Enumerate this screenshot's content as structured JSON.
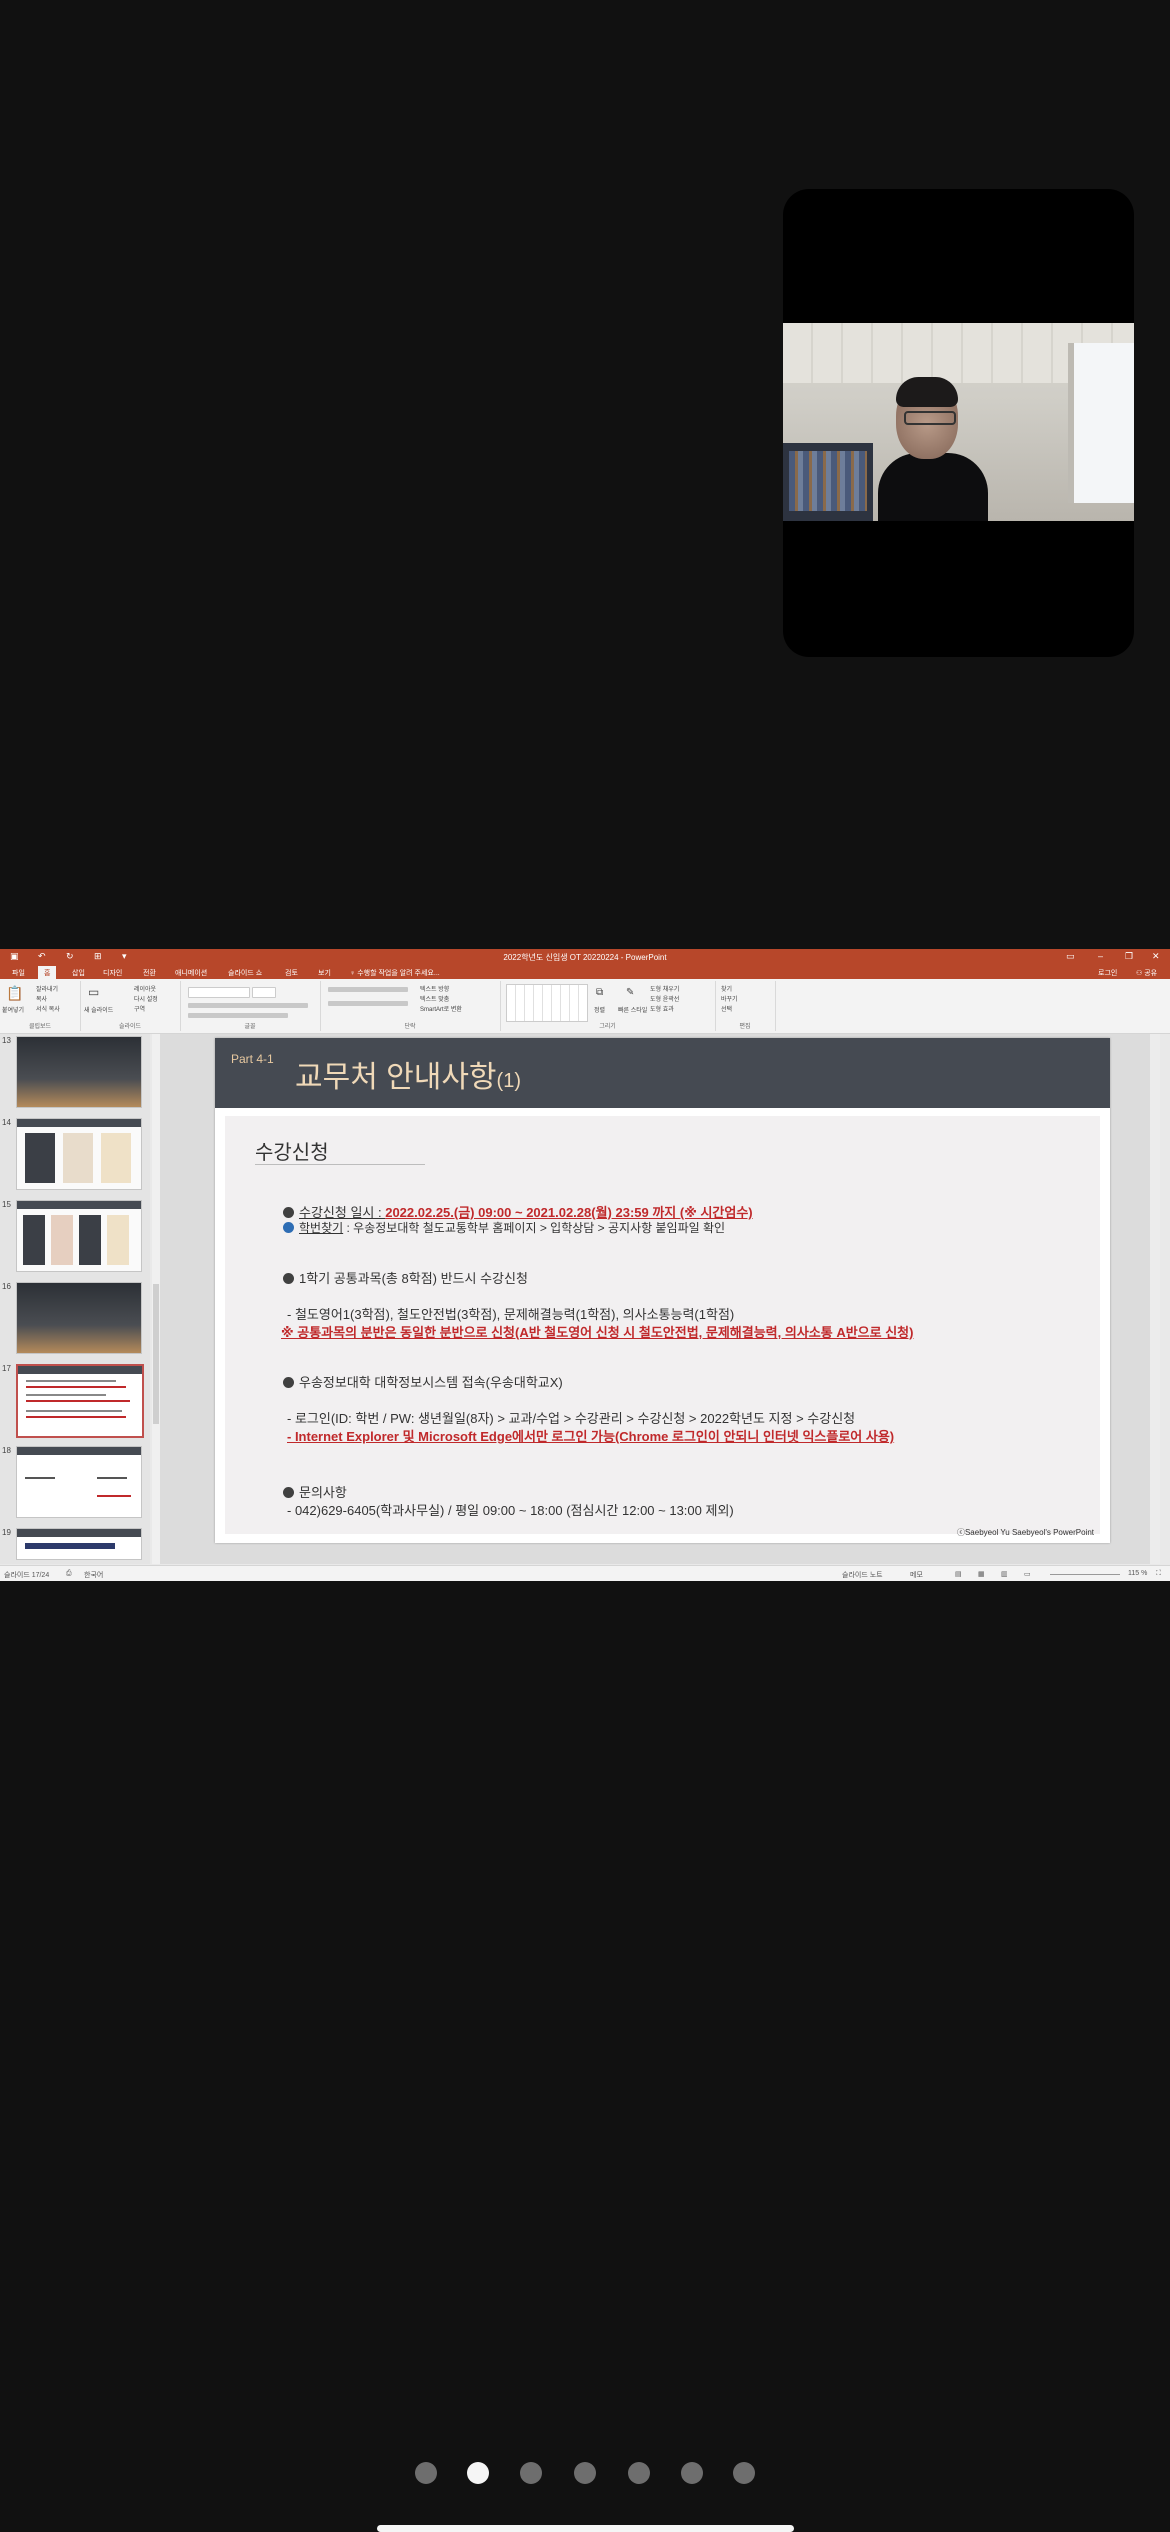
{
  "ppt": {
    "window_title": "2022학년도 신입생 OT 20220224 - PowerPoint",
    "tabs": [
      "파일",
      "홈",
      "삽입",
      "디자인",
      "전환",
      "애니메이션",
      "슬라이드 쇼",
      "검토",
      "보기"
    ],
    "search_hint": "수행할 작업을 알려 주세요...",
    "right_labels": [
      "로그인",
      "공유"
    ],
    "ribbon_groups": [
      "클립보드",
      "슬라이드",
      "글꼴",
      "단락",
      "그리기",
      "편집"
    ],
    "ribbon_buttons": {
      "paste": "붙여넣기",
      "cut": "잘라내기",
      "copy": "복사",
      "format_painter": "서식 복사",
      "new_slide": "새 슬라이드",
      "layout": "레이아웃",
      "reset": "다시 설정",
      "section": "구역",
      "text_direction": "텍스트 방향",
      "align_text": "텍스트 맞춤",
      "smartart": "SmartArt로 변환",
      "arrange": "정렬",
      "quick_styles": "빠른 스타일",
      "shape_fill": "도형 채우기",
      "shape_outline": "도형 윤곽선",
      "shape_effects": "도형 효과",
      "find": "찾기",
      "replace": "바꾸기",
      "select": "선택"
    },
    "thumbnails": [
      {
        "num": "13",
        "kind": "photo"
      },
      {
        "num": "14",
        "kind": "cards"
      },
      {
        "num": "15",
        "kind": "cards"
      },
      {
        "num": "16",
        "kind": "photo"
      },
      {
        "num": "17",
        "kind": "text",
        "active": true
      },
      {
        "num": "18",
        "kind": "text"
      },
      {
        "num": "19",
        "kind": "text"
      }
    ],
    "slide": {
      "part_label": "Part 4-1",
      "title_main": "교무처 안내사항",
      "title_sub": "(1)",
      "section_title": "수강신청",
      "l1_prefix": "수강신청 일시 : ",
      "l1_red": "2022.02.25.(금) 09:00 ~ 2021.02.28(월) 23:59 까지 (※ 시간엄수)",
      "l2_prefix": "학번찾기",
      "l2_text": " : 우송정보대학 철도교통학부 홈페이지 > 입학상담 > 공지사항 붙임파일 확인",
      "l3": "1학기 공통과목(총 8학점) 반드시 수강신청",
      "l4": "- 철도영어1(3학점), 철도안전법(3학점), 문제해결능력(1학점), 의사소통능력(1학점)",
      "l5": "※ 공통과목의 분반은 동일한 분반으로 신청(A반 철도영어 신청 시 철도안전법, 문제해결능력, 의사소통 A반으로 신청)",
      "l6": "우송정보대학 대학정보시스템 접속(우송대학교X)",
      "l7": "- 로그인(ID: 학번 / PW: 생년월일(8자) > 교과/수업 > 수강관리 > 수강신청 > 2022학년도 지정 > 수강신청",
      "l8": "- Internet Explorer 및 Microsoft Edge에서만 로그인 가능(Chrome 로그인이 안되니 인터넷 익스플로어 사용)",
      "l9": "문의사항",
      "l10": "- 042)629-6405(학과사무실) / 평일 09:00 ~ 18:00 (점심시간 12:00 ~ 13:00 제외)",
      "copyright": "ⓒSaebyeol Yu  Saebyeol's PowerPoint"
    },
    "status": {
      "slide_count": "슬라이드 17/24",
      "language": "한국어",
      "notes": "슬라이드 노트",
      "comments": "메모",
      "zoom": "115 %"
    }
  },
  "pager": {
    "count": 7,
    "active_index": 1
  }
}
